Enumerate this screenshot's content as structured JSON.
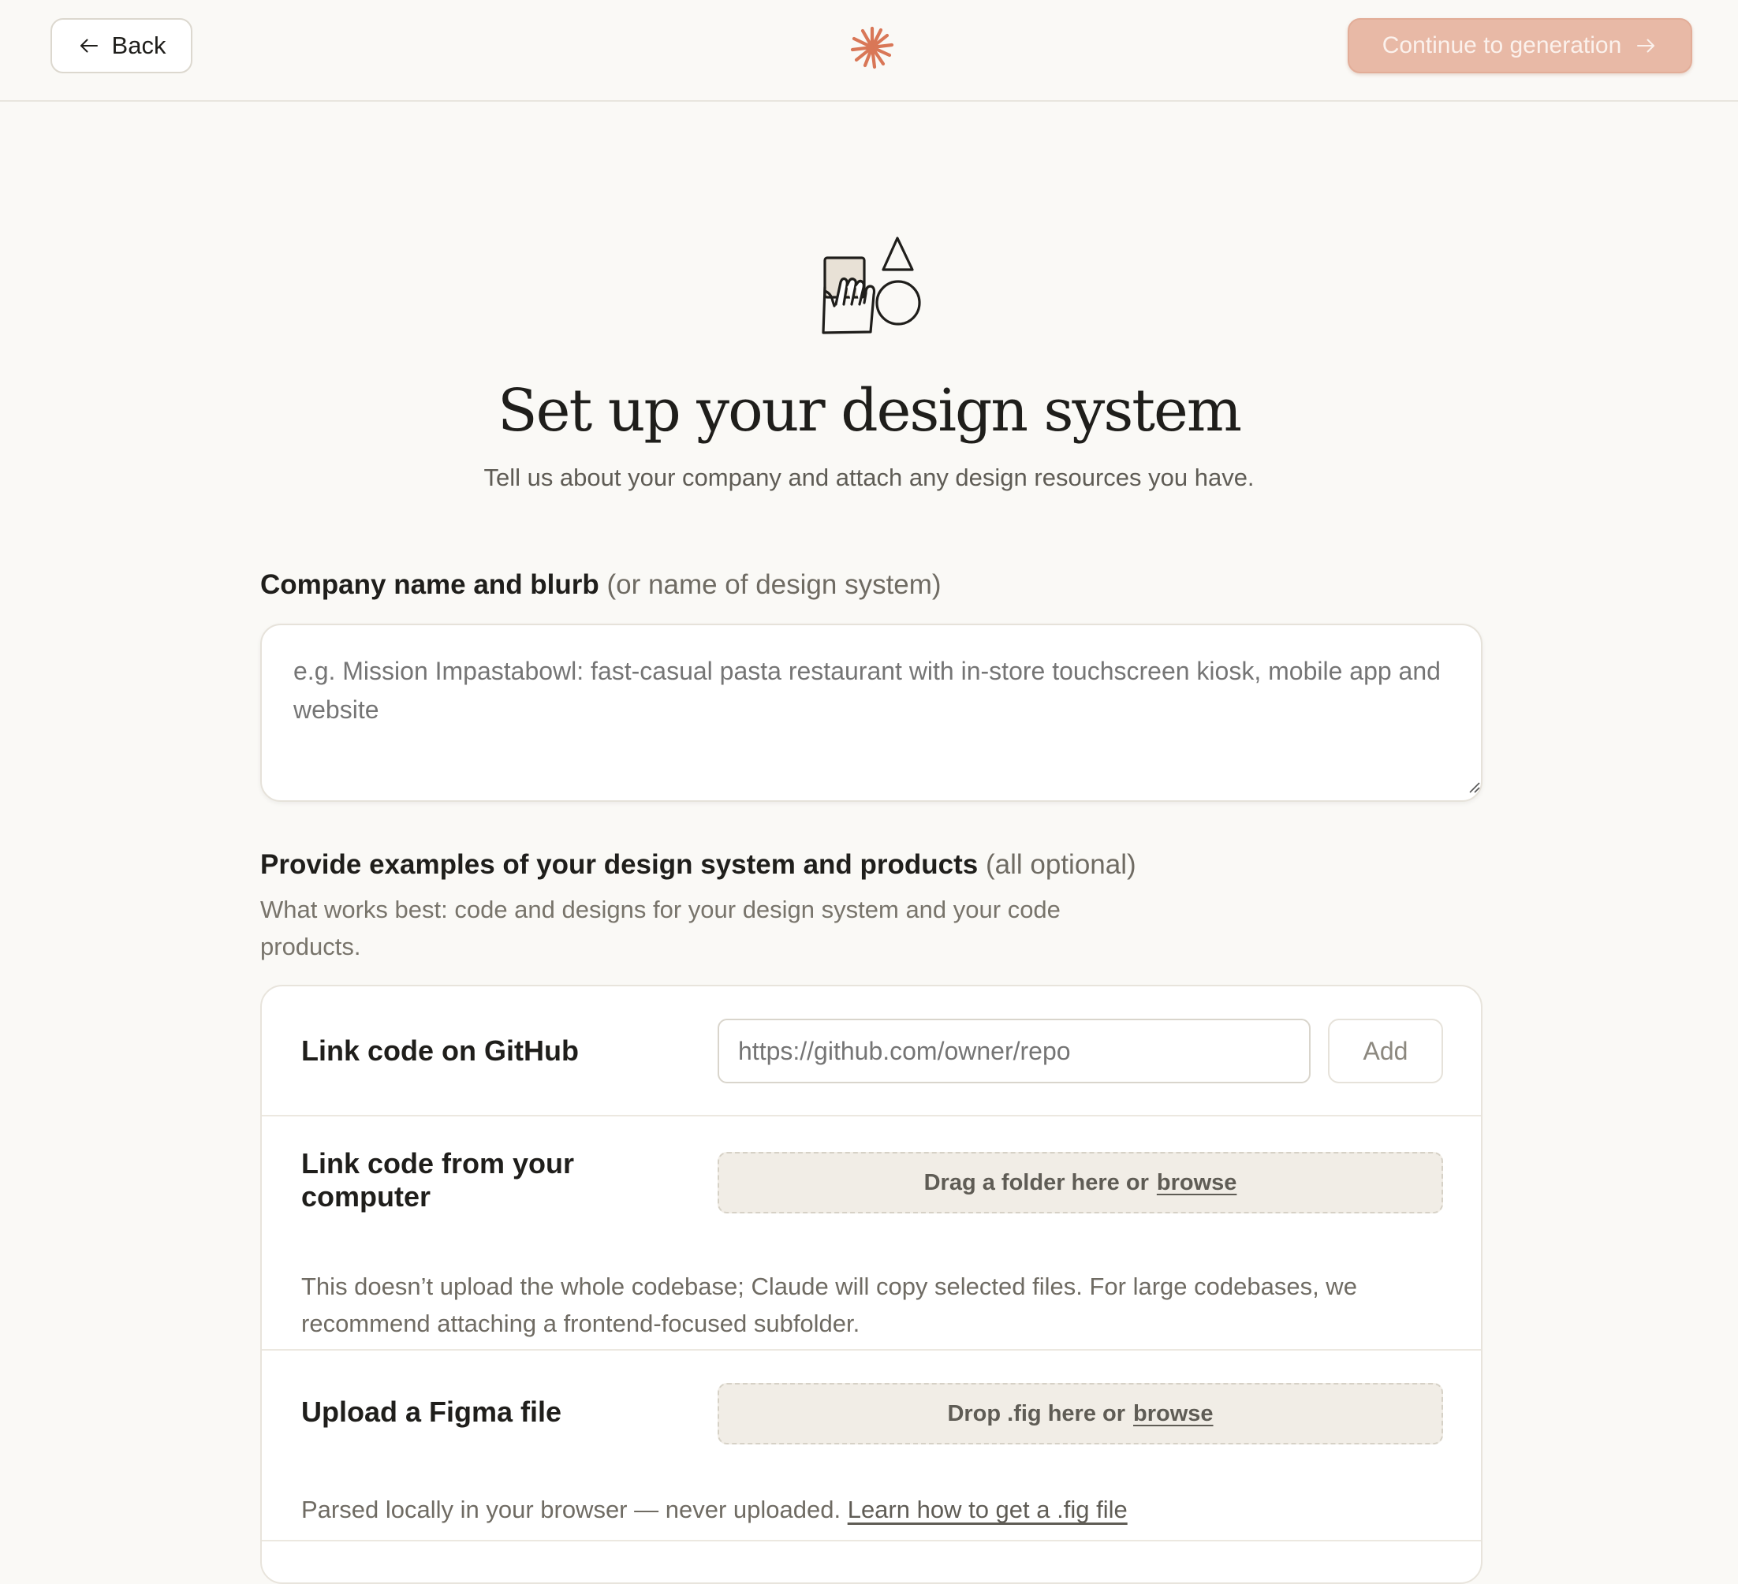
{
  "header": {
    "back_label": "Back",
    "continue_label": "Continue to generation",
    "accent_color": "#d97757"
  },
  "hero": {
    "title": "Set up your design system",
    "subtitle": "Tell us about your company and attach any design resources you have."
  },
  "company": {
    "label": "Company name and blurb",
    "label_hint": "(or name of design system)",
    "placeholder": "e.g. Mission Impastabowl: fast-casual pasta restaurant with in-store touchscreen kiosk, mobile app and website",
    "value": ""
  },
  "examples": {
    "label": "Provide examples of your design system and products",
    "label_hint": "(all optional)",
    "description": "What works best: code and designs for your design system and your code products.",
    "github": {
      "label": "Link code on GitHub",
      "placeholder": "https://github.com/owner/repo",
      "add_label": "Add"
    },
    "local_code": {
      "label": "Link code from your computer",
      "drop_text": "Drag a folder here or",
      "browse_label": "browse",
      "note": "This doesn’t upload the whole codebase; Claude will copy selected files. For large codebases, we recommend attaching a frontend-focused subfolder."
    },
    "figma": {
      "label": "Upload a Figma file",
      "drop_text": "Drop .fig here or",
      "browse_label": "browse",
      "note": "Parsed locally in your browser — never uploaded.",
      "note_link": "Learn how to get a .fig file"
    }
  }
}
